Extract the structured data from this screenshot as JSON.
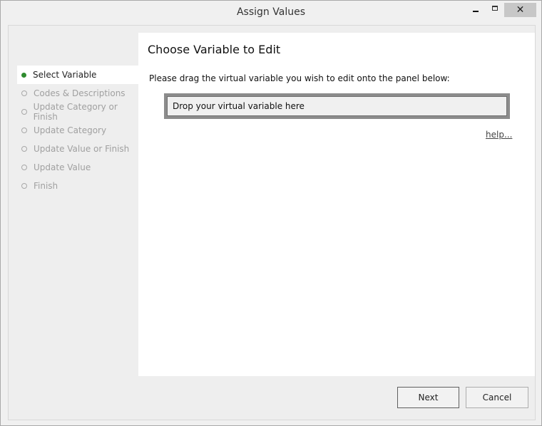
{
  "window": {
    "title": "Assign Values",
    "controls": {
      "minimize": "minimize-icon",
      "maximize": "maximize-icon",
      "close": "close-icon"
    }
  },
  "steps": [
    {
      "label": "Select Variable",
      "state": "current"
    },
    {
      "label": "Codes & Descriptions",
      "state": "pending"
    },
    {
      "label": "Update Category or Finish",
      "state": "pending"
    },
    {
      "label": "Update Category",
      "state": "pending"
    },
    {
      "label": "Update Value or Finish",
      "state": "pending"
    },
    {
      "label": "Update Value",
      "state": "pending"
    },
    {
      "label": "Finish",
      "state": "pending"
    }
  ],
  "main": {
    "heading": "Choose Variable to Edit",
    "instructions": "Please drag the virtual variable you wish to edit onto the panel below:",
    "dropzone_text": "Drop your virtual variable here",
    "help_link": "help..."
  },
  "footer": {
    "next_label": "Next",
    "cancel_label": "Cancel"
  },
  "colors": {
    "step_current_bullet": "#2e8b2e",
    "step_pending_text": "#a0a0a0"
  }
}
